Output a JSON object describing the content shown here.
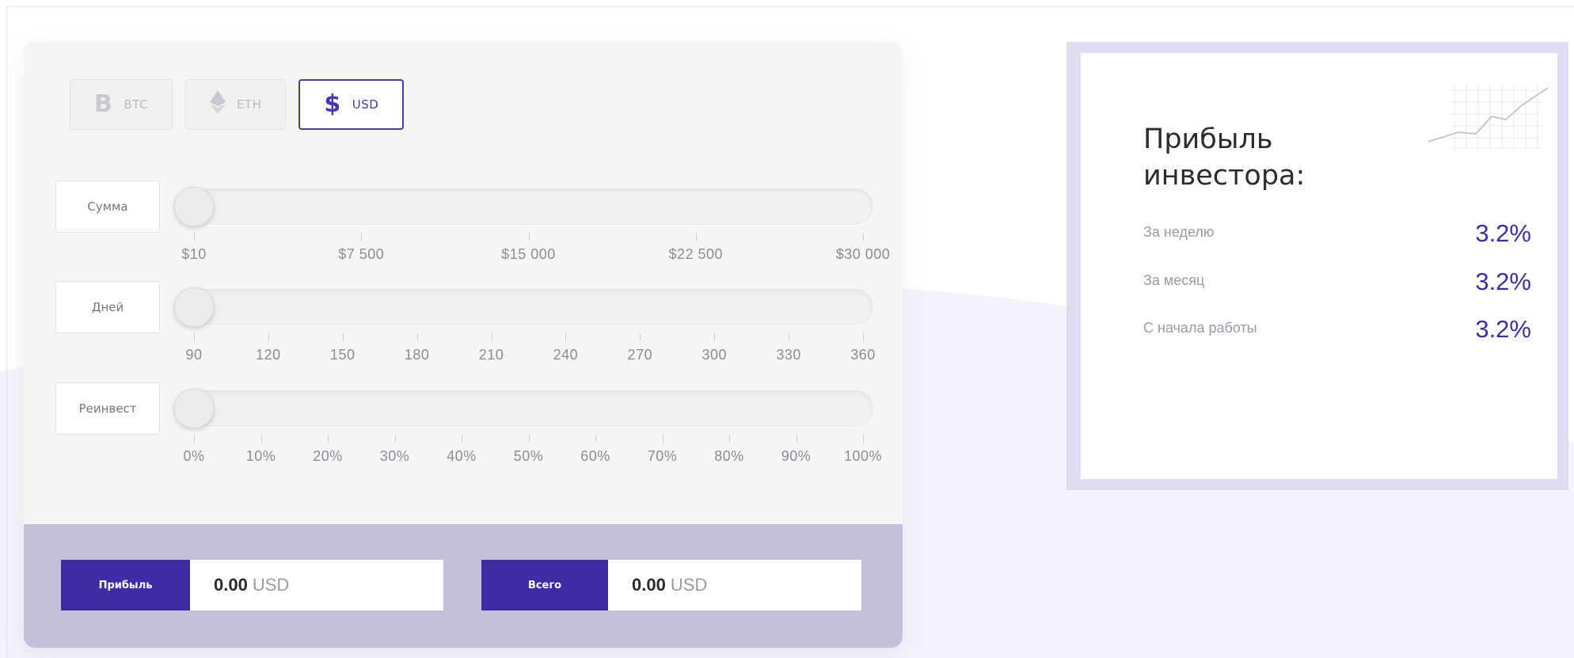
{
  "currencies": [
    {
      "symbol": "B",
      "label": "BTC",
      "active": false
    },
    {
      "symbol": "◆",
      "label": "ETH",
      "active": false
    },
    {
      "symbol": "$",
      "label": "USD",
      "active": true
    }
  ],
  "sliders": [
    {
      "label": "Сумма",
      "ticks": [
        "$10",
        "$7 500",
        "$15 000",
        "$22 500",
        "$30 000"
      ],
      "value": "$10"
    },
    {
      "label": "Дней",
      "ticks": [
        "90",
        "120",
        "150",
        "180",
        "210",
        "240",
        "270",
        "300",
        "330",
        "360"
      ],
      "value": "90"
    },
    {
      "label": "Реинвест",
      "ticks": [
        "0%",
        "10%",
        "20%",
        "30%",
        "40%",
        "50%",
        "60%",
        "70%",
        "80%",
        "90%",
        "100%"
      ],
      "value": "0%"
    }
  ],
  "results": {
    "profit_label": "Прибыль",
    "profit_amount": "0.00",
    "profit_currency": "USD",
    "total_label": "Всего",
    "total_amount": "0.00",
    "total_currency": "USD"
  },
  "investor": {
    "title": "Прибыль инвестора:",
    "rows": [
      {
        "label": "За неделю",
        "value": "3.2%"
      },
      {
        "label": "За месяц",
        "value": "3.2%"
      },
      {
        "label": "С начала работы",
        "value": "3.2%"
      }
    ]
  },
  "colors": {
    "accent": "#3f2ba3",
    "footer_bg": "#c3c0dc",
    "panel_border": "#dedcf0",
    "value_text": "#3b2ea6"
  }
}
